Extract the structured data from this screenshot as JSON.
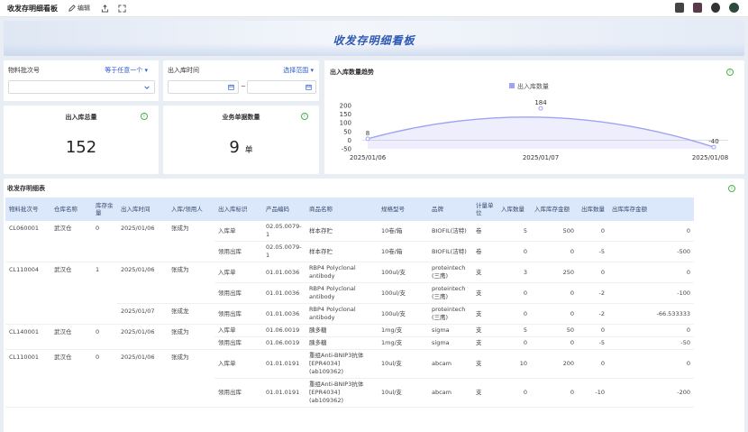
{
  "topbar": {
    "title": "收发存明细看板",
    "edit_label": "编辑"
  },
  "banner": {
    "title": "收发存明细看板"
  },
  "filters": {
    "material": {
      "label": "物料批次号",
      "operator": "等于任意一个 ▾"
    },
    "date": {
      "label": "出入库时间",
      "operator": "选择范围 ▾",
      "separator": "~"
    }
  },
  "kpis": [
    {
      "title": "出入库总量",
      "value": "152",
      "unit": ""
    },
    {
      "title": "业务单据数量",
      "value": "9",
      "unit": "单"
    }
  ],
  "trend": {
    "title": "出入库数量趋势",
    "chart_data": {
      "type": "line",
      "series": [
        {
          "name": "出入库数量",
          "values": [
            8,
            184,
            -40
          ]
        }
      ],
      "x": [
        "2025/01/06",
        "2025/01/07",
        "2025/01/08"
      ],
      "yticks": [
        200,
        150,
        100,
        50,
        0,
        -50
      ],
      "ylim": [
        -50,
        200
      ],
      "data_labels": [
        "8",
        "184",
        "-40"
      ],
      "color": "#9fa3f5"
    }
  },
  "table": {
    "title": "收发存明细表",
    "headers": [
      "物料批次号",
      "仓库名称",
      "库存余量",
      "出入库时间",
      "入库/领用人",
      "出入库标识",
      "产品编码",
      "商品名称",
      "规格型号",
      "品牌",
      "计量单位",
      "入库数量",
      "入库库存金额",
      "出库数量",
      "出库库存金额"
    ],
    "rows": [
      {
        "grp": [
          "CL060001",
          "武汉仓",
          "0"
        ],
        "time": "2025/01/06",
        "person": "张成为",
        "flag": "入库单",
        "code": "02.05.0079-1",
        "name": "样本存贮",
        "spec": "10卷/箱",
        "brand": "BIOFIL(洁特)",
        "unit": "卷",
        "in_qty": "5",
        "in_amt": "500",
        "out_qty": "0",
        "out_amt": "0"
      },
      {
        "flag": "领用出库",
        "code": "02.05.0079-1",
        "name": "样本存贮",
        "spec": "10卷/箱",
        "brand": "BIOFIL(洁特)",
        "unit": "卷",
        "in_qty": "0",
        "in_amt": "0",
        "out_qty": "-5",
        "out_amt": "-500"
      },
      {
        "grp": [
          "CL110004",
          "武汉仓",
          "1"
        ],
        "time": "2025/01/06",
        "person": "张成为",
        "flag": "入库单",
        "code": "01.01.0036",
        "name": "RBP4 Polyclonal antibody",
        "spec": "100ul/支",
        "brand": "proteintech (三鹰)",
        "unit": "支",
        "in_qty": "3",
        "in_amt": "250",
        "out_qty": "0",
        "out_amt": "0"
      },
      {
        "flag": "领用出库",
        "code": "01.01.0036",
        "name": "RBP4 Polyclonal antibody",
        "spec": "100ul/支",
        "brand": "proteintech (三鹰)",
        "unit": "支",
        "in_qty": "0",
        "in_amt": "0",
        "out_qty": "-2",
        "out_amt": "-100"
      },
      {
        "time": "2025/01/07",
        "person": "张成龙",
        "flag": "领用出库",
        "code": "01.01.0036",
        "name": "RBP4 Polyclonal antibody",
        "spec": "100ul/支",
        "brand": "proteintech (三鹰)",
        "unit": "支",
        "in_qty": "0",
        "in_amt": "0",
        "out_qty": "-2",
        "out_amt": "-66.533333"
      },
      {
        "grp": [
          "CL140001",
          "武汉仓",
          "0"
        ],
        "time": "2025/01/06",
        "person": "张成为",
        "flag": "入库单",
        "code": "01.06.0019",
        "name": "胰多糖",
        "spec": "1mg/支",
        "brand": "sigma",
        "unit": "支",
        "in_qty": "5",
        "in_amt": "50",
        "out_qty": "0",
        "out_amt": "0"
      },
      {
        "flag": "领用出库",
        "code": "01.06.0019",
        "name": "胰多糖",
        "spec": "1mg/支",
        "brand": "sigma",
        "unit": "支",
        "in_qty": "0",
        "in_amt": "0",
        "out_qty": "-5",
        "out_amt": "-50"
      },
      {
        "grp": [
          "CL110001",
          "武汉仓",
          "0"
        ],
        "time": "2025/01/06",
        "person": "张成为",
        "flag": "入库单",
        "code": "01.01.0191",
        "name": "重组Anti-BNIP3抗体 [EPR4034] (ab109362)",
        "spec": "10ul/支",
        "brand": "abcam",
        "unit": "支",
        "in_qty": "10",
        "in_amt": "200",
        "out_qty": "0",
        "out_amt": "0"
      },
      {
        "flag": "领用出库",
        "code": "01.01.0191",
        "name": "重组Anti-BNIP3抗体 [EPR4034] (ab109362)",
        "spec": "10ul/支",
        "brand": "abcam",
        "unit": "支",
        "in_qty": "0",
        "in_amt": "0",
        "out_qty": "-10",
        "out_amt": "-200"
      }
    ]
  }
}
